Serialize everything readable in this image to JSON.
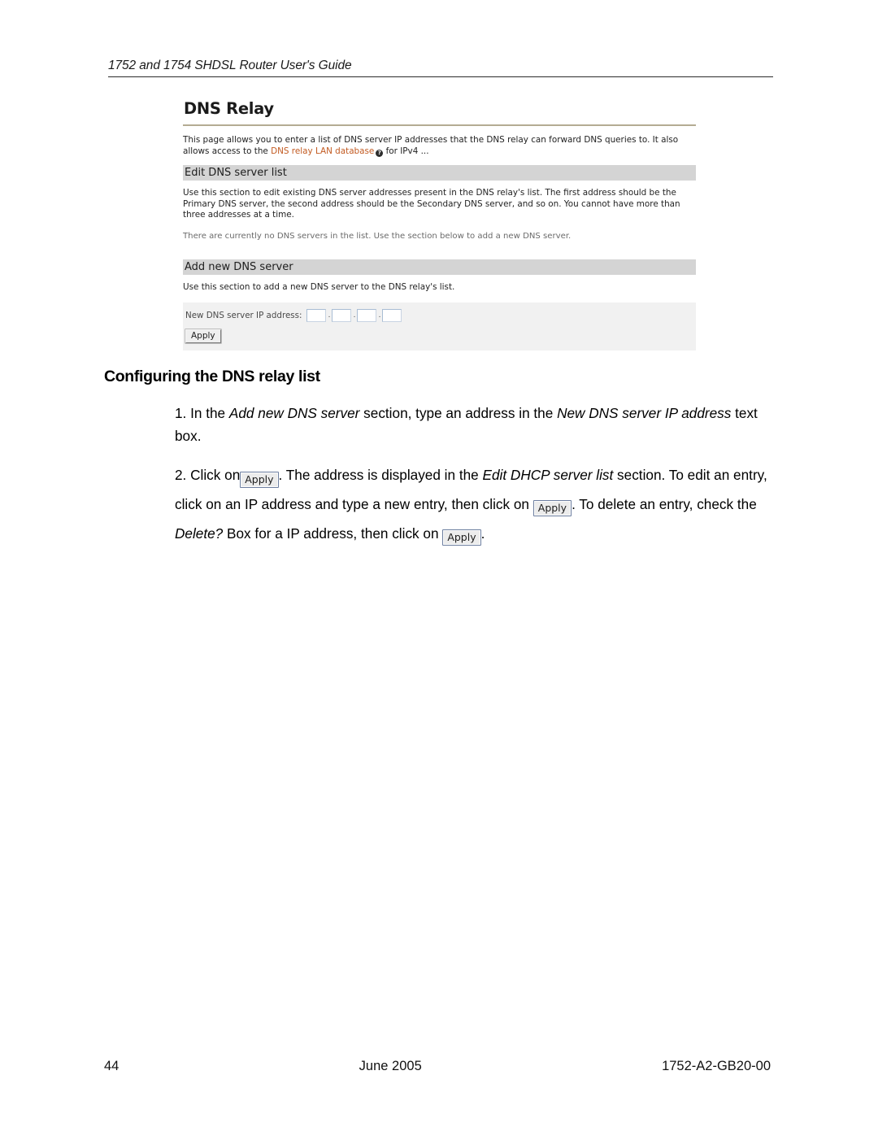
{
  "header": {
    "running_title": "1752 and 1754 SHDSL Router User's Guide"
  },
  "screenshot": {
    "title": "DNS Relay",
    "intro_line1": "This page allows you to enter a list of DNS server IP addresses that the DNS relay can forward DNS queries to. It also",
    "intro_line2_prefix": "allows access to the ",
    "intro_link": "DNS relay LAN database",
    "intro_help_icon": "help-icon",
    "intro_help_glyph": "?",
    "intro_line2_suffix": " for IPv4 ...",
    "edit_section": {
      "bar_label": "Edit DNS server list",
      "body": "Use this section to edit existing DNS server addresses present in the DNS relay's list. The first address should be the Primary DNS server, the second address should be the Secondary DNS server, and so on. You cannot have more than three addresses at a time.",
      "note": "There are currently no DNS servers in the list. Use the section below to add a new DNS server."
    },
    "add_section": {
      "bar_label": "Add new DNS server",
      "body": "Use this section to add a new DNS server to the DNS relay's list.",
      "field_label": "New DNS server IP address:",
      "octets": [
        "",
        "",
        "",
        ""
      ],
      "separator": ".",
      "apply_label": "Apply"
    },
    "link_color": "#c25a21",
    "bar_color": "#d4d4d4",
    "form_bg_color": "#f1f1f1",
    "title_rule_color": "#b4ac93"
  },
  "section": {
    "heading": "Configuring the DNS relay list"
  },
  "steps": {
    "step1": {
      "number": "1.",
      "t1": " In the ",
      "em1": "Add new DNS server",
      "t2": " section, type an address in the ",
      "em2": "New DNS server IP address",
      "t3": " text box."
    },
    "step2": {
      "number": "2.",
      "t1": " Click on",
      "btn1": "Apply",
      "t2": ". The address is displayed in the ",
      "em1": "Edit DHCP server list",
      "t3": " section. To edit an entry, click on an IP address and type a new entry, then click on ",
      "btn2": "Apply",
      "t4": ". To delete an entry, check the ",
      "em2": "Delete?",
      "t5": " Box for a IP address, then click on ",
      "btn3": "Apply",
      "t6": "."
    }
  },
  "footer": {
    "page_number": "44",
    "date": "June 2005",
    "document_number": "1752-A2-GB20-00"
  }
}
